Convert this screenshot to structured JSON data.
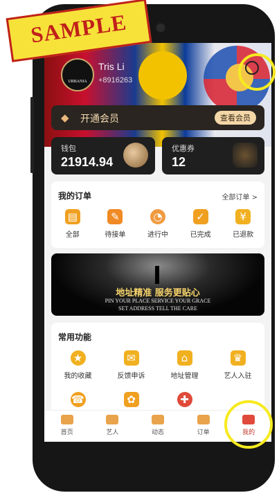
{
  "watermark": "SAMPLE",
  "profile": {
    "name": "Tris Li",
    "phone": "+8916263",
    "avatar_text": "URBANIA"
  },
  "vip": {
    "label": "开通会员",
    "button": "查看会员"
  },
  "wallet": {
    "title": "钱包",
    "value": "21914.94"
  },
  "coupon": {
    "title": "优惠券",
    "value": "12"
  },
  "orders": {
    "title": "我的订单",
    "more": "全部订单 >",
    "items": [
      {
        "label": "全部",
        "icon": "orders-all-icon",
        "color": "#f0a020"
      },
      {
        "label": "待接单",
        "icon": "pending-icon",
        "color": "#f08a24"
      },
      {
        "label": "进行中",
        "icon": "in-progress-icon",
        "color": "#f09a40"
      },
      {
        "label": "已完成",
        "icon": "completed-icon",
        "color": "#f0a020"
      },
      {
        "label": "已退款",
        "icon": "refund-icon",
        "color": "#f0b020"
      }
    ]
  },
  "banner": {
    "headline": "地址精准 服务更贴心",
    "line1": "PIN YOUR PLACE SERVICE YOUR GRACE",
    "line2": "SET ADDRESS TELL THE CARE"
  },
  "common": {
    "title": "常用功能",
    "items": [
      {
        "label": "我的收藏",
        "icon": "favorites-icon",
        "color": "#f0b020"
      },
      {
        "label": "反馈申诉",
        "icon": "feedback-icon",
        "color": "#f0b020"
      },
      {
        "label": "地址管理",
        "icon": "address-icon",
        "color": "#f0b020"
      },
      {
        "label": "艺人入驻",
        "icon": "crown-icon",
        "color": "#f0b020"
      }
    ],
    "row2": [
      {
        "label": "",
        "icon": "service-icon",
        "color": "#f0a020"
      },
      {
        "label": "",
        "icon": "gift-icon",
        "color": "#f0a020"
      },
      {
        "label": "",
        "icon": "shield-icon",
        "color": "#e04a3a"
      }
    ]
  },
  "tabs": [
    {
      "label": "首页",
      "icon": "home-tab-icon",
      "color": "#e9a34b"
    },
    {
      "label": "艺人",
      "icon": "artist-tab-icon",
      "color": "#e9a34b"
    },
    {
      "label": "动态",
      "icon": "moments-tab-icon",
      "color": "#e9a34b"
    },
    {
      "label": "订单",
      "icon": "orders-tab-icon",
      "color": "#e9a34b"
    },
    {
      "label": "我的",
      "icon": "me-tab-icon",
      "color": "#e04a3a"
    }
  ]
}
